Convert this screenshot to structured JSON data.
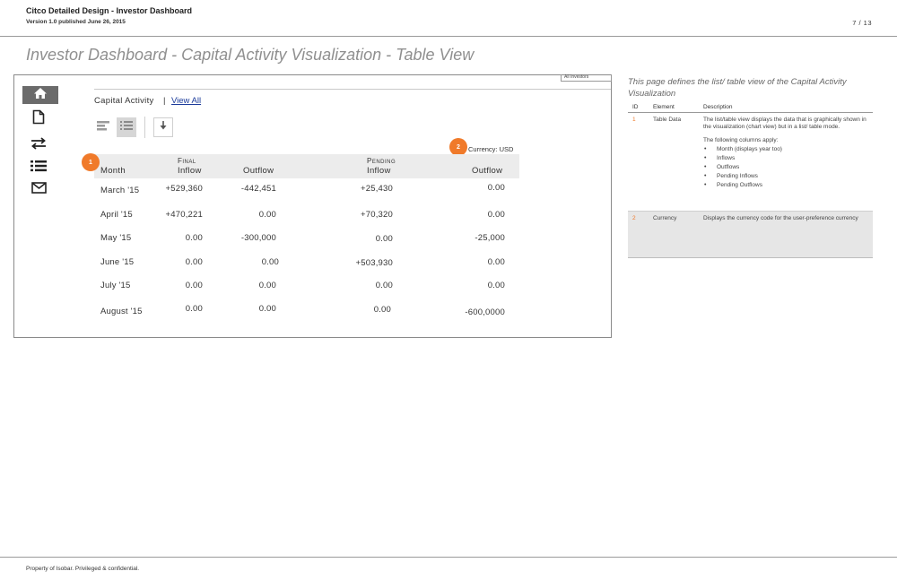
{
  "header": {
    "title": "Citco Detailed Design - Investor Dashboard",
    "version": "Version 1.0 published June 26, 2015",
    "page": "7 / 13"
  },
  "page_title": "Investor Dashboard - Capital Activity Visualization - Table View",
  "mockup": {
    "investor_dropdown": "All Investors",
    "nav_icons": [
      "home-icon",
      "document-icon",
      "transfer-icon",
      "list-icon",
      "envelope-icon"
    ],
    "section_label": "Capital Activity",
    "separator": "|",
    "view_all": "View All",
    "currency_label": "Currency: USD",
    "badges": [
      "1",
      "2"
    ],
    "table": {
      "group_final": "Final",
      "group_pending": "Pending",
      "columns": [
        "Month",
        "Inflow",
        "Outflow",
        "Inflow",
        "Outflow"
      ],
      "rows": [
        [
          "March '15",
          "+529,360",
          "-442,451",
          "+25,430",
          "0.00"
        ],
        [
          "April '15",
          "+470,221",
          "0.00",
          "+70,320",
          "0.00"
        ],
        [
          "May '15",
          "0.00",
          "-300,000",
          "0.00",
          "-25,000"
        ],
        [
          "June '15",
          "0.00",
          "0.00",
          "+503,930",
          "0.00"
        ],
        [
          "July '15",
          "0.00",
          "0.00",
          "0.00",
          "0.00"
        ],
        [
          "August '15",
          "0.00",
          "0.00",
          "0.00",
          "-600,0000"
        ]
      ]
    }
  },
  "spec": {
    "intro": "This page defines the list/ table view of the Capital Activity Visualization",
    "headers": [
      "ID",
      "Element",
      "Description"
    ],
    "rows": [
      {
        "id": "1",
        "element": "Table Data",
        "description": "The list/table view displays the data that is graphically shown in the visualization (chart view) but in a list/ table mode.",
        "description2": "The following columns apply:",
        "bullets": [
          "Month (displays year too)",
          "Inflows",
          "Outflows",
          "Pending Inflows",
          "Pending Outflows"
        ]
      },
      {
        "id": "2",
        "element": "Currency",
        "description": "Displays the currency code for the user-preference currency"
      }
    ]
  },
  "footer": "Property of Isobar. Privileged & confidential."
}
